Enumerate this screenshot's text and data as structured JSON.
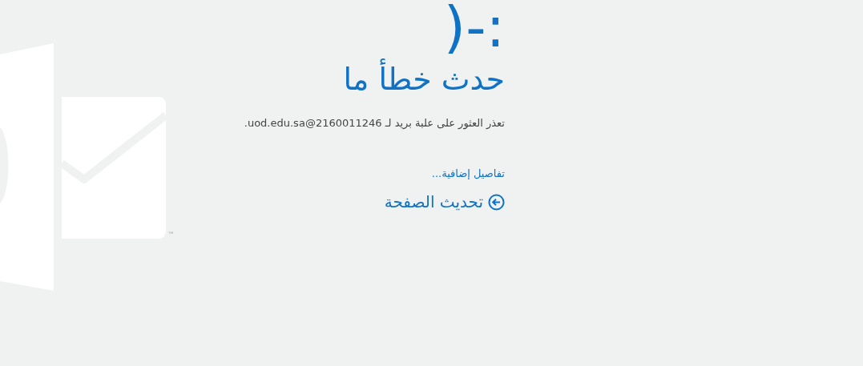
{
  "logo": {
    "trademark": "™"
  },
  "error": {
    "emoticon": ":-(",
    "title": "حدث خطأ ما",
    "message": "تعذر العثور على علبة بريد لـ 2160011246@uod.edu.sa."
  },
  "details_link": "تفاصيل إضافية...",
  "refresh_link": "تحديث الصفحة"
}
